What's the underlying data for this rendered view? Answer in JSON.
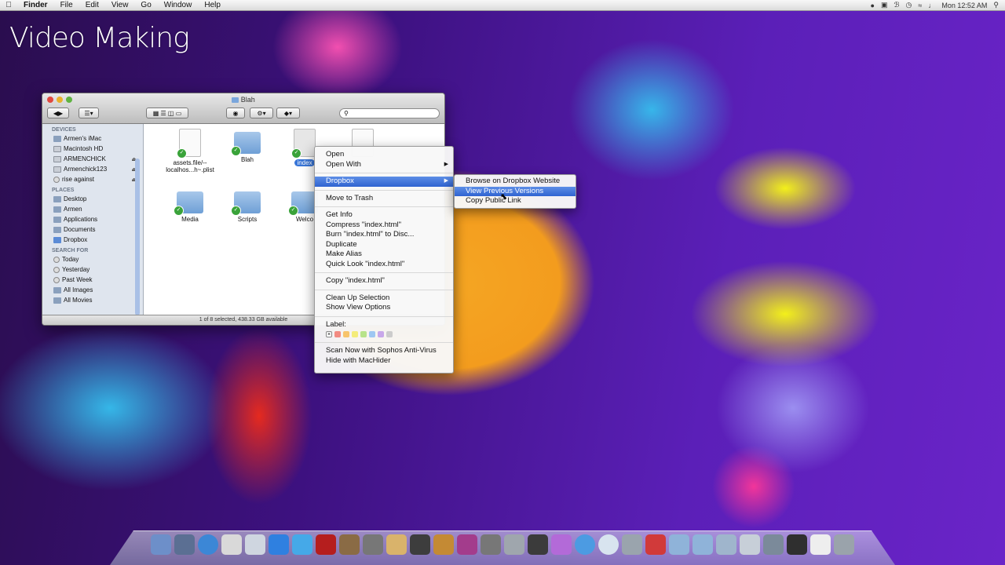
{
  "menubar": {
    "app": "Finder",
    "items": [
      "File",
      "Edit",
      "View",
      "Go",
      "Window",
      "Help"
    ],
    "clock": "Mon 12:52 AM"
  },
  "watermark": "Video Making",
  "window": {
    "title": "Blah",
    "search_placeholder": "",
    "status": "1 of 8 selected, 438.33 GB available"
  },
  "sidebar": {
    "devices_header": "DEVICES",
    "devices": [
      "Armen's iMac",
      "Macintosh HD",
      "ARMENCHICK",
      "Armenchick123",
      "rise against"
    ],
    "places_header": "PLACES",
    "places": [
      "Desktop",
      "Armen",
      "Applications",
      "Documents",
      "Dropbox"
    ],
    "search_header": "SEARCH FOR",
    "search": [
      "Today",
      "Yesterday",
      "Past Week",
      "All Images",
      "All Movies"
    ]
  },
  "files": [
    {
      "name": "assets.file/--\nlocalhos...h~.plist",
      "kind": "doc"
    },
    {
      "name": "Blah",
      "kind": "folder"
    },
    {
      "name": "index",
      "kind": "doc",
      "selected": true
    },
    {
      "name": "",
      "kind": "doc"
    },
    {
      "name": "Media",
      "kind": "folder"
    },
    {
      "name": "Scripts",
      "kind": "folder"
    },
    {
      "name": "Welco",
      "kind": "folder"
    }
  ],
  "context_menu": {
    "open": "Open",
    "open_with": "Open With",
    "dropbox": "Dropbox",
    "move_to_trash": "Move to Trash",
    "get_info": "Get Info",
    "compress": "Compress \"index.html\"",
    "burn": "Burn \"index.html\" to Disc...",
    "duplicate": "Duplicate",
    "make_alias": "Make Alias",
    "quick_look": "Quick Look \"index.html\"",
    "copy": "Copy \"index.html\"",
    "clean_up": "Clean Up Selection",
    "show_view_options": "Show View Options",
    "label": "Label:",
    "scan": "Scan Now with Sophos Anti-Virus",
    "hide": "Hide with MacHider"
  },
  "submenu": {
    "browse": "Browse on Dropbox Website",
    "versions": "View Previous Versions",
    "copy_link": "Copy Public Link"
  },
  "label_colors": [
    "#f28b82",
    "#f7c46c",
    "#f4ec7a",
    "#b7e38a",
    "#9ec7f2",
    "#c8a8ea",
    "#cccccc"
  ],
  "dock_colors": [
    "#6d8fc9",
    "#5b6f93",
    "#3c87d6",
    "#d9d9d9",
    "#cfd6e0",
    "#2f80e0",
    "#45a9e8",
    "#b51e1e",
    "#8a6b45",
    "#777",
    "#d9b36b",
    "#3d3d3d",
    "#c48a34",
    "#a33c8c",
    "#777",
    "#9fa6ad",
    "#3b3b3b",
    "#b36ad8",
    "#4c9be2",
    "#d8e4ef",
    "#9aa4ad",
    "#d13a3a",
    "#8fb3d9",
    "#8fb3d9",
    "#9fb5cc",
    "#c7cfd8",
    "#7b8a9a",
    "#2f2f2f",
    "#eeeeee",
    "#9aa3ab"
  ]
}
